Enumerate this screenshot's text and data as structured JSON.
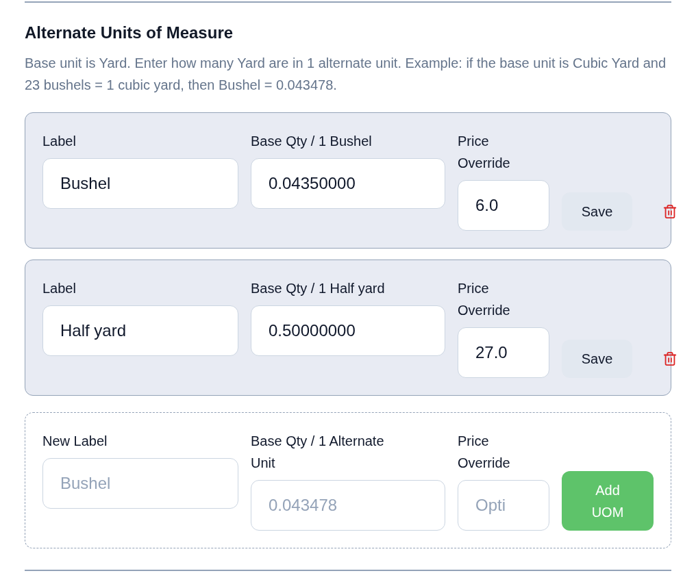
{
  "section": {
    "title": "Alternate Units of Measure",
    "description": "Base unit is Yard. Enter how many Yard are in 1 alternate unit. Example: if the base unit is Cubic Yard and 23 bushels = 1 cubic yard, then Bushel = 0.043478."
  },
  "units": [
    {
      "kind": "saved",
      "label_field": {
        "label": "Label",
        "value": "Bushel"
      },
      "qty_field": {
        "label": "Base Qty / 1 Bushel",
        "value": "0.04350000"
      },
      "price_field": {
        "label": "Price Override",
        "value": "6.0"
      },
      "button": "Save"
    },
    {
      "kind": "saved",
      "label_field": {
        "label": "Label",
        "value": "Half yard"
      },
      "qty_field": {
        "label": "Base Qty / 1 Half yard",
        "value": "0.50000000"
      },
      "price_field": {
        "label": "Price Override",
        "value": "27.0"
      },
      "button": "Save"
    },
    {
      "kind": "new",
      "label_field": {
        "label": "New Label",
        "placeholder": "Bushel"
      },
      "qty_field": {
        "label": "Base Qty / 1 Alternate Unit",
        "placeholder": "0.043478"
      },
      "price_field": {
        "label": "Price Override",
        "placeholder": "Opti"
      },
      "button": "Add UOM"
    }
  ]
}
